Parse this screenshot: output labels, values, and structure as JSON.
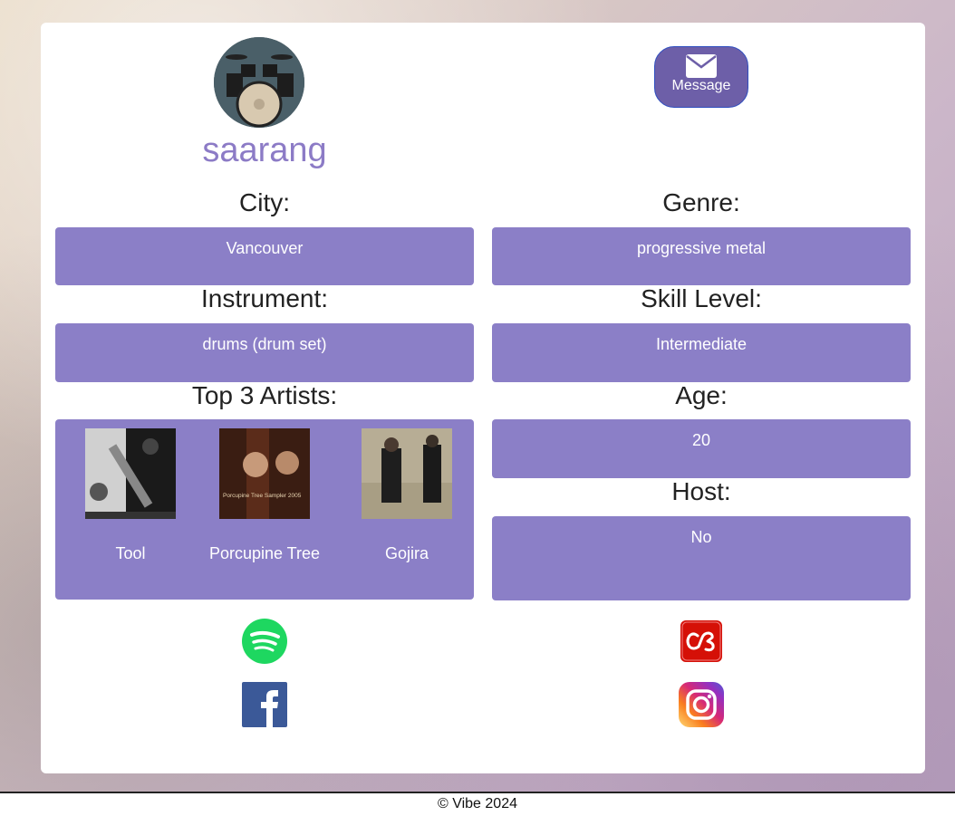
{
  "profile": {
    "username": "saarang",
    "message_label": "Message"
  },
  "fields": {
    "city": {
      "label": "City:",
      "value": "Vancouver"
    },
    "genre": {
      "label": "Genre:",
      "value": "progressive metal"
    },
    "instrument": {
      "label": "Instrument:",
      "value": "drums (drum set)"
    },
    "skill": {
      "label": "Skill Level:",
      "value": "Intermediate"
    },
    "artists_label": "Top 3 Artists:",
    "age": {
      "label": "Age:",
      "value": "20"
    },
    "host": {
      "label": "Host:",
      "value": "No"
    }
  },
  "artists": [
    {
      "name": "Tool"
    },
    {
      "name": "Porcupine Tree"
    },
    {
      "name": "Gojira"
    }
  ],
  "album_text": {
    "porcupine_cover": "Porcupine Tree Sampler 2005"
  },
  "social": [
    "spotify-icon",
    "lastfm-icon",
    "facebook-icon",
    "instagram-icon"
  ],
  "colors": {
    "accent": "#8b7fc7",
    "username": "#8c7bc6",
    "message_bg": "#6d5fa8",
    "spotify": "#1ed760",
    "lastfm": "#d51007",
    "facebook": "#3b5998"
  },
  "footer": {
    "text": "© Vibe 2024"
  }
}
